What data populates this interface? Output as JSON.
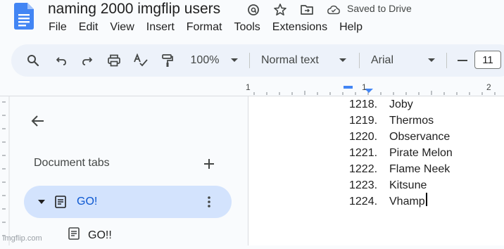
{
  "document": {
    "title": "naming 2000 imgflip users",
    "save_status": "Saved to Drive"
  },
  "menu": [
    "File",
    "Edit",
    "View",
    "Insert",
    "Format",
    "Tools",
    "Extensions",
    "Help"
  ],
  "toolbar": {
    "zoom": "100%",
    "style": "Normal text",
    "font": "Arial",
    "font_size": "11"
  },
  "ruler": {
    "labels": [
      "1",
      "1",
      "2"
    ]
  },
  "side_panel": {
    "title": "Document tabs",
    "tabs": [
      {
        "label": "GO!",
        "selected": true
      },
      {
        "label": "GO!!",
        "selected": false
      }
    ]
  },
  "doc_list": [
    {
      "num": "1218.",
      "text": "Joby"
    },
    {
      "num": "1219.",
      "text": "Thermos"
    },
    {
      "num": "1220.",
      "text": "Observance"
    },
    {
      "num": "1221.",
      "text": "Pirate Melon"
    },
    {
      "num": "1222.",
      "text": "Flame Neek"
    },
    {
      "num": "1223.",
      "text": "Kitsune"
    },
    {
      "num": "1224.",
      "text": "Vhamp"
    }
  ],
  "watermark": "imgflip.com",
  "colors": {
    "docs_blue": "#4285f4",
    "active_tab_bg": "#d3e3fd",
    "active_tab_text": "#0b57d0",
    "toolbar_bg": "#edf2fa",
    "page_bg": "#f9fbfd"
  }
}
